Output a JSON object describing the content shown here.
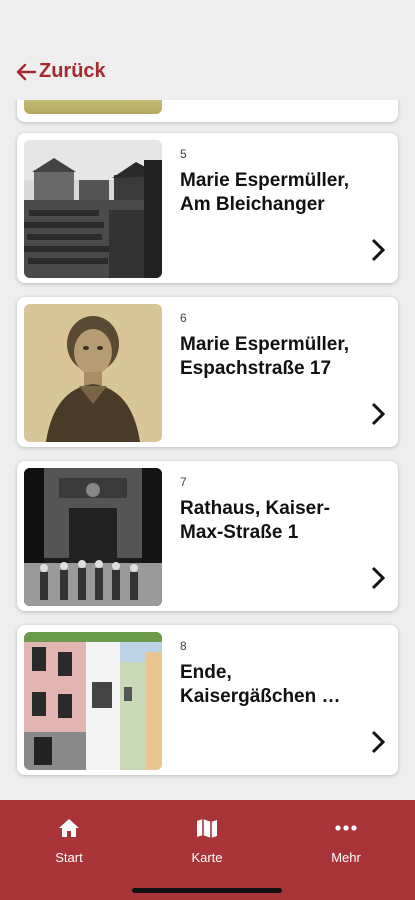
{
  "header": {
    "back_label": "Zurück"
  },
  "colors": {
    "accent": "#a83438",
    "background": "#eeeeee"
  },
  "stations": [
    {
      "number": "5",
      "title": "Marie Espermüller,\nAm Bleichanger",
      "image": "historic-town-photo"
    },
    {
      "number": "6",
      "title": "Marie Espermüller,\nEspachstraße 17",
      "image": "portrait-photo"
    },
    {
      "number": "7",
      "title": "Rathaus, Kaiser-\nMax-Straße 1",
      "image": "town-hall-photo"
    },
    {
      "number": "8",
      "title": "Ende,\nKaisergäßchen …",
      "image": "street-houses-photo"
    }
  ],
  "tabbar": {
    "items": [
      {
        "label": "Start",
        "icon": "home-icon"
      },
      {
        "label": "Karte",
        "icon": "map-icon"
      },
      {
        "label": "Mehr",
        "icon": "more-icon"
      }
    ]
  }
}
